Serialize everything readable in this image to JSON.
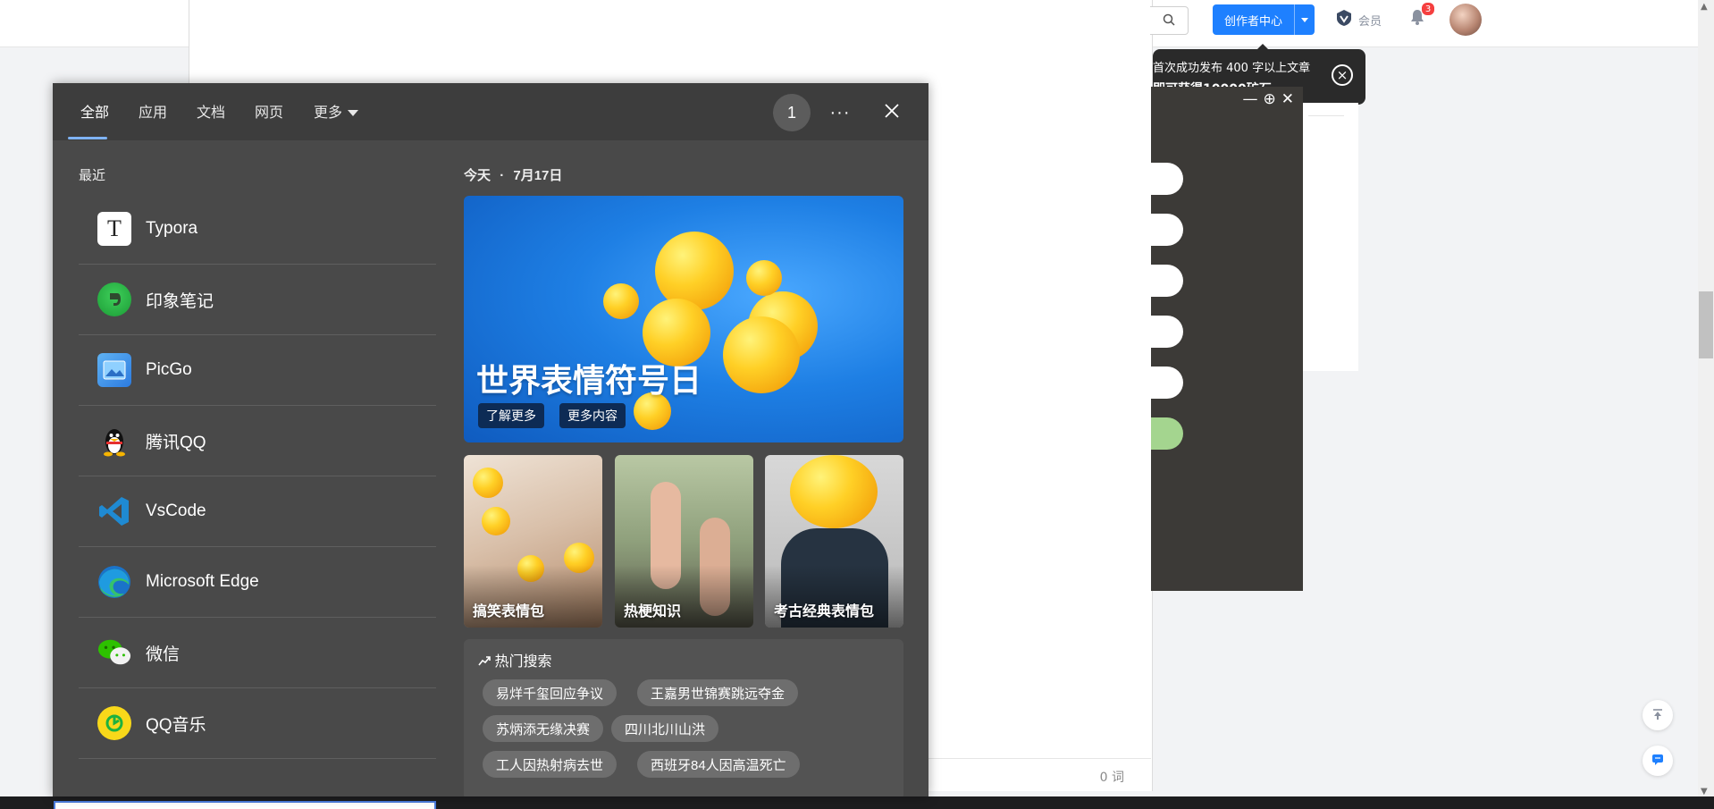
{
  "header": {
    "creator_center": "创作者中心",
    "vip": "会员",
    "notification_count": "3"
  },
  "tooltip": {
    "line1": "首次成功发布 400 字以上文章",
    "line2": "即可获得10000矿石"
  },
  "editor": {
    "word_count": "0 词"
  },
  "search_flyout": {
    "tabs": [
      "全部",
      "应用",
      "文档",
      "网页",
      "更多"
    ],
    "result_count": "1",
    "more_label": "···",
    "recent_title": "最近",
    "recent_apps": [
      {
        "name": "Typora",
        "icon": "typora-icon"
      },
      {
        "name": "印象笔记",
        "icon": "evernote-icon"
      },
      {
        "name": "PicGo",
        "icon": "picgo-icon"
      },
      {
        "name": "腾讯QQ",
        "icon": "qq-icon"
      },
      {
        "name": "VsCode",
        "icon": "vscode-icon"
      },
      {
        "name": "Microsoft Edge",
        "icon": "edge-icon"
      },
      {
        "name": "微信",
        "icon": "wechat-icon"
      },
      {
        "name": "QQ音乐",
        "icon": "qqmusic-icon"
      }
    ],
    "today_label": "今天",
    "today_date": "7月17日",
    "hero": {
      "title": "世界表情符号日",
      "btn_learn": "了解更多",
      "btn_more": "更多内容"
    },
    "cards": [
      "搞笑表情包",
      "热梗知识",
      "考古经典表情包"
    ],
    "hot_title": "热门搜索",
    "hot_searches": [
      "易烊千玺回应争议",
      "王嘉男世锦赛跳远夺金",
      "苏炳添无缘决赛",
      "四川北川山洪",
      "工人因热射病去世",
      "西班牙84人因高温死亡"
    ]
  },
  "colors": {
    "accent": "#1e80ff",
    "flyout_bg": "#494949",
    "tab_underline": "#7fb3f4"
  }
}
